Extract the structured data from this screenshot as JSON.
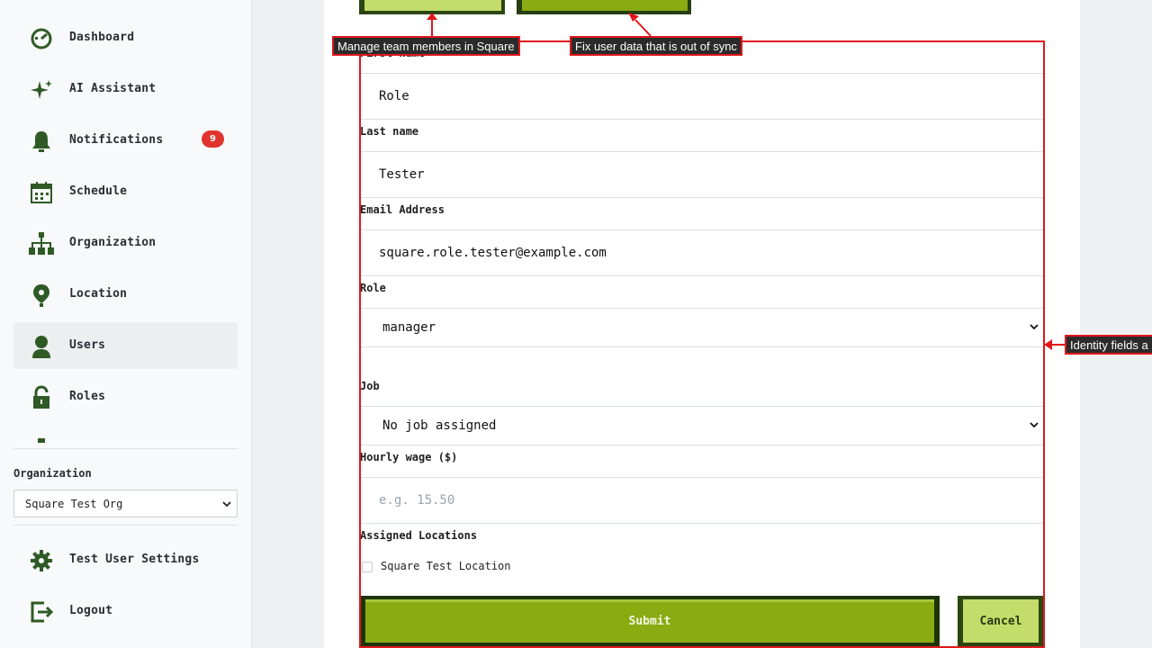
{
  "sidebar": {
    "items": [
      {
        "label": "Dashboard",
        "icon": "dashboard-icon"
      },
      {
        "label": "AI Assistant",
        "icon": "sparkle-icon"
      },
      {
        "label": "Notifications",
        "icon": "bell-icon",
        "badge": "9"
      },
      {
        "label": "Schedule",
        "icon": "calendar-icon"
      },
      {
        "label": "Organization",
        "icon": "org-chart-icon"
      },
      {
        "label": "Location",
        "icon": "map-pin-icon"
      },
      {
        "label": "Users",
        "icon": "user-icon",
        "active": true
      },
      {
        "label": "Roles",
        "icon": "lock-icon"
      }
    ],
    "organization_label": "Organization",
    "organization_selected": "Square Test Org",
    "bottom": [
      {
        "label": "Test User Settings",
        "icon": "gear-icon"
      },
      {
        "label": "Logout",
        "icon": "logout-icon"
      }
    ]
  },
  "form": {
    "first_name_label": "First name",
    "first_name_value": "Role",
    "last_name_label": "Last name",
    "last_name_value": "Tester",
    "email_label": "Email Address",
    "email_value": "square.role.tester@example.com",
    "role_label": "Role",
    "role_selected": "manager",
    "job_label": "Job",
    "job_selected": "No job assigned",
    "wage_label": "Hourly wage ($)",
    "wage_placeholder": "e.g. 15.50",
    "locations_label": "Assigned Locations",
    "location_option": "Square Test Location",
    "submit_label": "Submit",
    "cancel_label": "Cancel"
  },
  "annotations": {
    "manage": "Manage team members in Square",
    "fix": "Fix user data that is out of sync",
    "identity": "Identity fields a"
  },
  "colors": {
    "accent_green": "#8aab12",
    "light_green": "#c4dc6a",
    "dark_green": "#2b4712",
    "sidebar_icon": "#2f5a26",
    "badge_red": "#e0342f",
    "annotation_red": "#e0171d"
  }
}
